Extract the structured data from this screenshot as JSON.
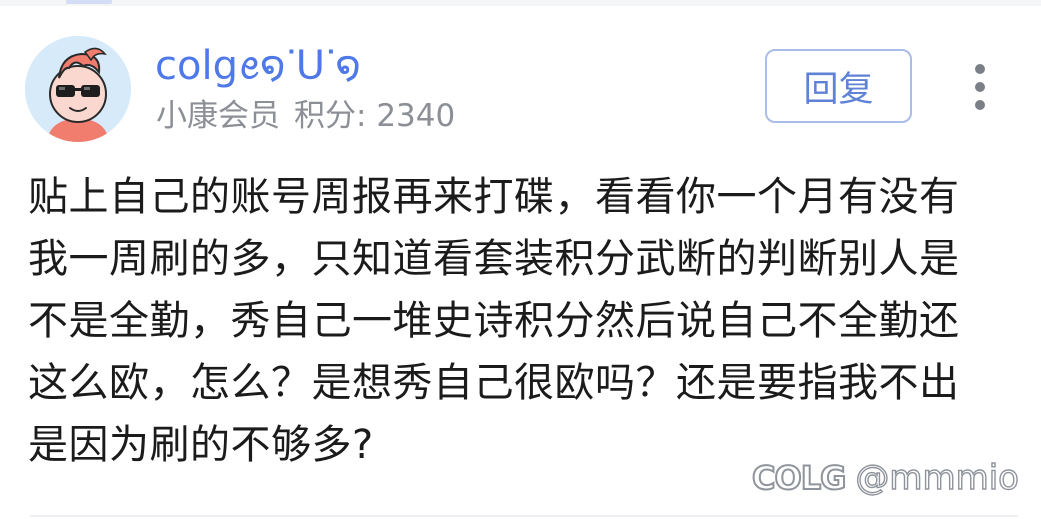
{
  "user": {
    "name": "colgꫀ໑ᐝᑌᐝ໑",
    "rank": "小康会员",
    "points_label": "积分:",
    "points": "2340"
  },
  "actions": {
    "reply_label": "回复",
    "more_icon": "more-vertical-icon"
  },
  "post": {
    "lines": [
      "贴上自己的账号周报再来打碟，看看你一个月有没有",
      "我一周刷的多，只知道看套装积分武断的判断别人是",
      "不是全勤，秀自己一堆史诗积分然后说自己不全勤还",
      "这么欧，怎么？是想秀自己很欧吗？还是要指我不出",
      "是因为刷的不够多?"
    ]
  },
  "watermark": {
    "logo": "COLG",
    "handle": "@mmmio"
  },
  "colors": {
    "username": "#4f79e8",
    "reply_border": "#a9bde6",
    "avatar_bg": "#d6eafa",
    "avatar_hair": "#f07d6e"
  }
}
